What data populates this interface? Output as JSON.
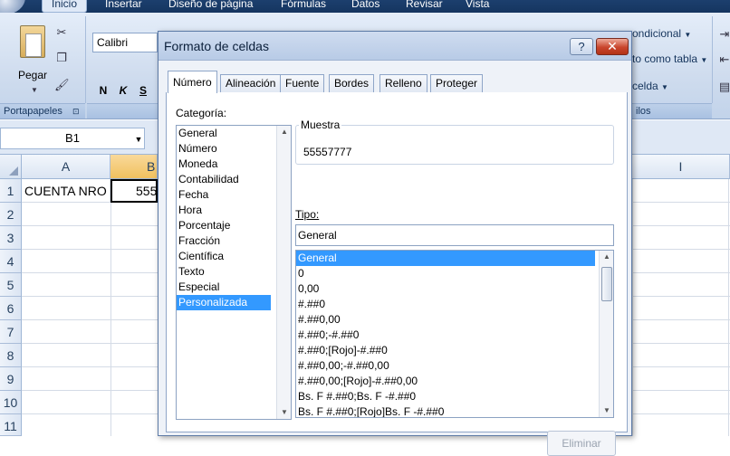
{
  "ribbon": {
    "tabs": [
      {
        "label": "Inicio",
        "active": true
      },
      {
        "label": "Insertar",
        "active": false
      },
      {
        "label": "Diseño de página",
        "active": false
      },
      {
        "label": "Fórmulas",
        "active": false
      },
      {
        "label": "Datos",
        "active": false
      },
      {
        "label": "Revisar",
        "active": false
      },
      {
        "label": "Vista",
        "active": false
      }
    ],
    "paste_label": "Pegar",
    "font_name": "Calibri",
    "bold": "N",
    "italic": "K",
    "underline": "S",
    "clipboard_group": "Portapapeles",
    "clipboard_launcher": "⊡",
    "right_items": [
      "ondicional",
      "to como tabla",
      "celda"
    ],
    "styles_group": "ilos"
  },
  "formula_bar": {
    "name_box": "B1"
  },
  "sheet": {
    "columns": [
      "A",
      "B",
      "I"
    ],
    "selected_column": "B",
    "rows": [
      "1",
      "2",
      "3",
      "4",
      "5",
      "6",
      "7",
      "8",
      "9",
      "10",
      "11"
    ],
    "cells": {
      "A1": "CUENTA NRO",
      "B1": "555"
    }
  },
  "dialog": {
    "title": "Formato de celdas",
    "help": "?",
    "close": "✕",
    "tabs": [
      {
        "label": "Número",
        "active": true
      },
      {
        "label": "Alineación",
        "active": false
      },
      {
        "label": "Fuente",
        "active": false
      },
      {
        "label": "Bordes",
        "active": false
      },
      {
        "label": "Relleno",
        "active": false
      },
      {
        "label": "Proteger",
        "active": false
      }
    ],
    "category_label": "Categoría:",
    "categories": [
      "General",
      "Número",
      "Moneda",
      "Contabilidad",
      "Fecha",
      "Hora",
      "Porcentaje",
      "Fracción",
      "Científica",
      "Texto",
      "Especial",
      "Personalizada"
    ],
    "selected_category": "Personalizada",
    "sample_label": "Muestra",
    "sample_value": "55557777",
    "type_label": "Tipo:",
    "type_value": "General",
    "types": [
      "General",
      "0",
      "0,00",
      "#.##0",
      "#.##0,00",
      "#.##0;-#.##0",
      "#.##0;[Rojo]-#.##0",
      "#.##0,00;-#.##0,00",
      "#.##0,00;[Rojo]-#.##0,00",
      "Bs. F #.##0;Bs. F -#.##0",
      "Bs. F #.##0;[Rojo]Bs. F -#.##0"
    ],
    "selected_type": "General",
    "delete_button": "Eliminar"
  },
  "colors": {
    "selection": "#3399ff",
    "ribbon_tab_bar": "#15355f",
    "selected_header": "#f1c15f"
  }
}
